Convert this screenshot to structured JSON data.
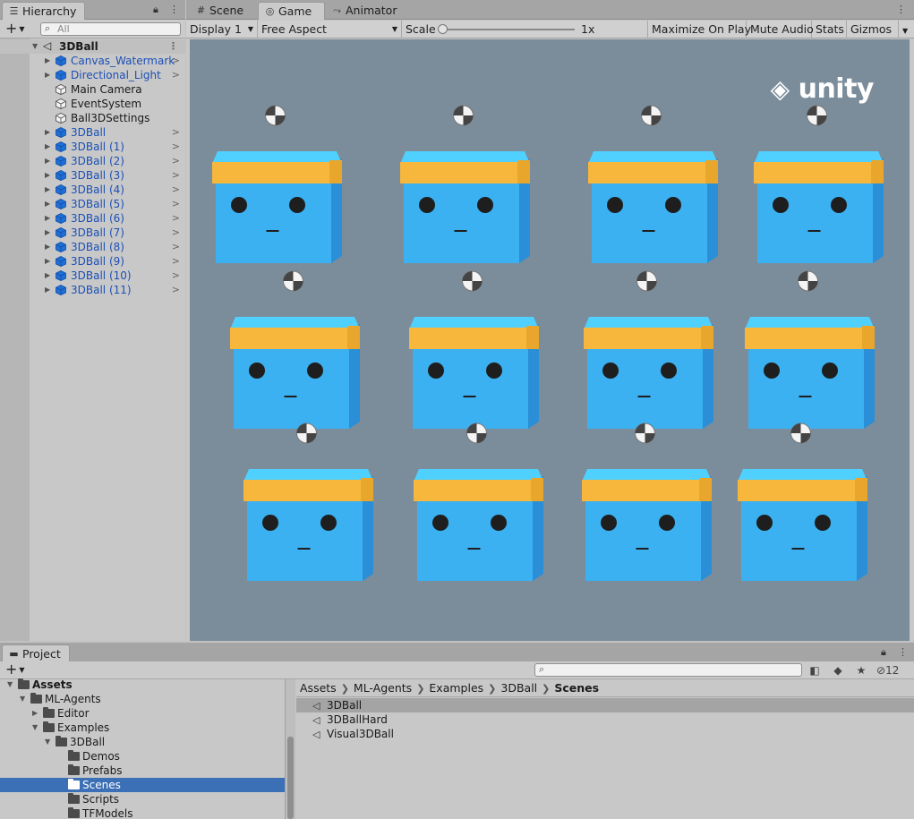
{
  "hierarchy": {
    "tab_label": "Hierarchy",
    "search_placeholder": "All",
    "scene_name": "3DBall",
    "items": [
      {
        "label": "Canvas_Watermark",
        "blue": true,
        "arrow": true
      },
      {
        "label": "Directional_Light",
        "blue": true,
        "arrow": true
      },
      {
        "label": "Main Camera",
        "blue": false,
        "arrow": false
      },
      {
        "label": "EventSystem",
        "blue": false,
        "arrow": false
      },
      {
        "label": "Ball3DSettings",
        "blue": false,
        "arrow": false
      },
      {
        "label": "3DBall",
        "blue": true,
        "arrow": true
      },
      {
        "label": "3DBall (1)",
        "blue": true,
        "arrow": true
      },
      {
        "label": "3DBall (2)",
        "blue": true,
        "arrow": true
      },
      {
        "label": "3DBall (3)",
        "blue": true,
        "arrow": true
      },
      {
        "label": "3DBall (4)",
        "blue": true,
        "arrow": true
      },
      {
        "label": "3DBall (5)",
        "blue": true,
        "arrow": true
      },
      {
        "label": "3DBall (6)",
        "blue": true,
        "arrow": true
      },
      {
        "label": "3DBall (7)",
        "blue": true,
        "arrow": true
      },
      {
        "label": "3DBall (8)",
        "blue": true,
        "arrow": true
      },
      {
        "label": "3DBall (9)",
        "blue": true,
        "arrow": true
      },
      {
        "label": "3DBall (10)",
        "blue": true,
        "arrow": true
      },
      {
        "label": "3DBall (11)",
        "blue": true,
        "arrow": true
      }
    ]
  },
  "main_tabs": [
    {
      "label": "Scene",
      "active": false,
      "icon": "grid-icon"
    },
    {
      "label": "Game",
      "active": true,
      "icon": "gamepad-icon"
    },
    {
      "label": "Animator",
      "active": false,
      "icon": "animator-icon"
    }
  ],
  "game_toolbar": {
    "display": "Display 1",
    "aspect": "Free Aspect",
    "scale_label": "Scale",
    "scale_value": "1x",
    "scale_fraction": 0.0,
    "maximize": "Maximize On Play",
    "mute": "Mute Audio",
    "stats": "Stats",
    "gizmos": "Gizmos"
  },
  "viewport": {
    "logo_text": "unity",
    "background": "#7b8d9b",
    "cube_color": "#3bb1f2",
    "band_color": "#f6b73c",
    "agents": 12
  },
  "project": {
    "tab_label": "Project",
    "hidden_count": "12",
    "tree": [
      {
        "label": "Assets",
        "depth": 0,
        "expanded": true,
        "bold": true
      },
      {
        "label": "ML-Agents",
        "depth": 1,
        "expanded": true
      },
      {
        "label": "Editor",
        "depth": 2,
        "expanded": false
      },
      {
        "label": "Examples",
        "depth": 2,
        "expanded": true
      },
      {
        "label": "3DBall",
        "depth": 3,
        "expanded": true
      },
      {
        "label": "Demos",
        "depth": 4,
        "expanded": null
      },
      {
        "label": "Prefabs",
        "depth": 4,
        "expanded": null
      },
      {
        "label": "Scenes",
        "depth": 4,
        "expanded": null,
        "selected": true
      },
      {
        "label": "Scripts",
        "depth": 4,
        "expanded": null
      },
      {
        "label": "TFModels",
        "depth": 4,
        "expanded": null
      }
    ],
    "breadcrumb": [
      "Assets",
      "ML-Agents",
      "Examples",
      "3DBall",
      "Scenes"
    ],
    "files": [
      {
        "label": "3DBall",
        "selected": true
      },
      {
        "label": "3DBallHard",
        "selected": false
      },
      {
        "label": "Visual3DBall",
        "selected": false
      }
    ]
  }
}
